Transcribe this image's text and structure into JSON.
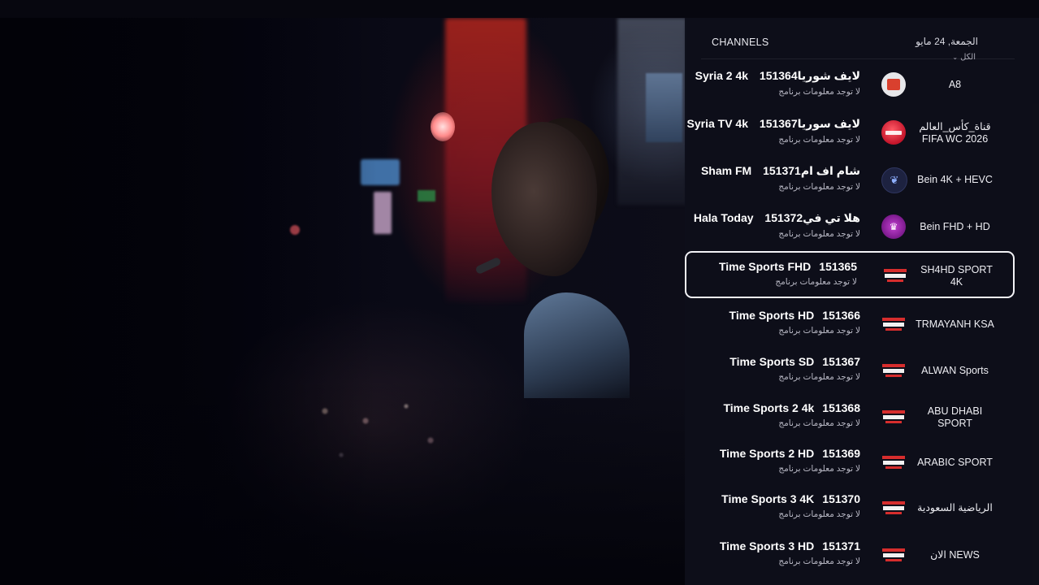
{
  "panel": {
    "title": "CHANNELS",
    "date": "الجمعة, 24 مايو",
    "filter": "الكل"
  },
  "channels": [
    {
      "name": "Syria 2 4k لايف شوريا",
      "number": "151364",
      "info": "لا توجد معلومات برنامج",
      "logo": "red-square-icon",
      "group": "A8"
    },
    {
      "name": "Syria TV 4k لايف سوريا",
      "number": "151367",
      "info": "لا توجد معلومات برنامج",
      "logo": "red-circle-icon",
      "group": "قناة_كأس_العالم FIFA WC 2026"
    },
    {
      "name": "Sham FM شام اف ام",
      "number": "151371",
      "info": "لا توجد معلومات برنامج",
      "logo": "dark-emblem-icon",
      "group": "Bein 4K + HEVC"
    },
    {
      "name": "Hala Today هلا تي في",
      "number": "151372",
      "info": "لا توجد معلومات برنامج",
      "logo": "purple-circle-icon",
      "group": "Bein FHD + HD"
    },
    {
      "name": "Time Sports FHD",
      "number": "151365",
      "info": "لا توجد معلومات برنامج",
      "logo": "time-sports-logo",
      "group": "SH4HD SPORT 4K",
      "selected": true
    },
    {
      "name": "Time Sports HD",
      "number": "151366",
      "info": "لا توجد معلومات برنامج",
      "logo": "time-sports-logo",
      "group": "TRMAYANH KSA"
    },
    {
      "name": "Time Sports SD",
      "number": "151367",
      "info": "لا توجد معلومات برنامج",
      "logo": "time-sports-logo",
      "group": "ALWAN Sports"
    },
    {
      "name": "Time Sports 2 4k",
      "number": "151368",
      "info": "لا توجد معلومات برنامج",
      "logo": "time-sports-logo",
      "group": "ABU DHABI SPORT"
    },
    {
      "name": "Time Sports 2 HD",
      "number": "151369",
      "info": "لا توجد معلومات برنامج",
      "logo": "time-sports-logo",
      "group": "ARABIC SPORT"
    },
    {
      "name": "Time Sports 3 4K",
      "number": "151370",
      "info": "لا توجد معلومات برنامج",
      "logo": "time-sports-logo",
      "group": "الرياضية السعودية"
    },
    {
      "name": "Time Sports 3 HD",
      "number": "151371",
      "info": "لا توجد معلومات برنامج",
      "logo": "time-sports-logo",
      "group": "الان NEWS"
    }
  ]
}
